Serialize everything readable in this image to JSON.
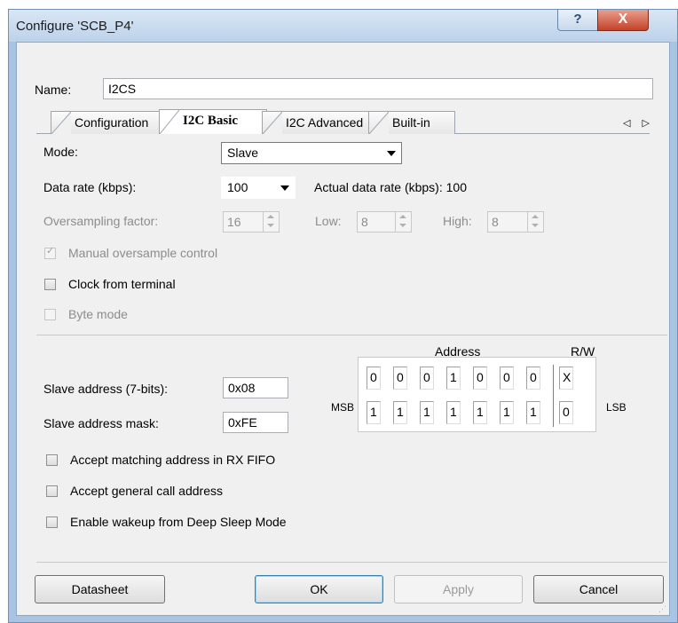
{
  "window": {
    "title": "Configure 'SCB_P4'",
    "help_glyph": "?",
    "close_glyph": "X"
  },
  "name_field": {
    "label": "Name:",
    "value": "I2CS"
  },
  "tabs": [
    {
      "label": "Configuration"
    },
    {
      "label": "I2C Basic"
    },
    {
      "label": "I2C Advanced"
    },
    {
      "label": "Built-in"
    }
  ],
  "tab_scroll": "◁ ▷",
  "mode": {
    "label": "Mode:",
    "value": "Slave"
  },
  "data_rate": {
    "label": "Data rate (kbps):",
    "value": "100",
    "actual_label": "Actual data rate (kbps): 100"
  },
  "oversampling": {
    "label": "Oversampling factor:",
    "value": "16",
    "low_label": "Low:",
    "low_value": "8",
    "high_label": "High:",
    "high_value": "8"
  },
  "checkboxes_top": [
    {
      "label": "Manual oversample control",
      "checked": true,
      "disabled": true
    },
    {
      "label": "Clock from terminal",
      "checked": false,
      "disabled": false
    },
    {
      "label": "Byte mode",
      "checked": false,
      "disabled": true
    }
  ],
  "address": {
    "header_address": "Address",
    "header_rw": "R/W",
    "slave_address_label": "Slave address (7-bits):",
    "slave_address_value": "0x08",
    "slave_mask_label": "Slave address mask:",
    "slave_mask_value": "0xFE",
    "msb": "MSB",
    "lsb": "LSB",
    "address_bits": [
      "0",
      "0",
      "0",
      "1",
      "0",
      "0",
      "0"
    ],
    "address_rw": "X",
    "mask_bits": [
      "1",
      "1",
      "1",
      "1",
      "1",
      "1",
      "1"
    ],
    "mask_rw": "0"
  },
  "checkboxes_bottom": [
    {
      "label": "Accept matching address in RX FIFO"
    },
    {
      "label": "Accept general call address"
    },
    {
      "label": "Enable wakeup from Deep Sleep Mode"
    }
  ],
  "buttons": {
    "datasheet": "Datasheet",
    "ok": "OK",
    "apply": "Apply",
    "cancel": "Cancel"
  }
}
